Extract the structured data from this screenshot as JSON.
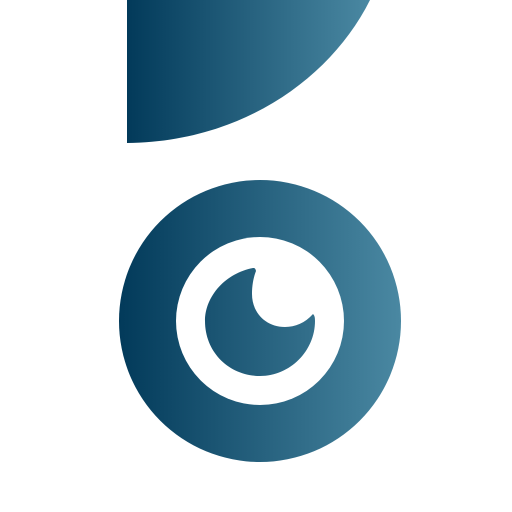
{
  "icon_name": "eye-logo-icon",
  "colors": {
    "background": "#ffffff",
    "gradient_start": "#023a5a",
    "gradient_end": "#4a88a2",
    "inner_ring": "#ffffff"
  }
}
